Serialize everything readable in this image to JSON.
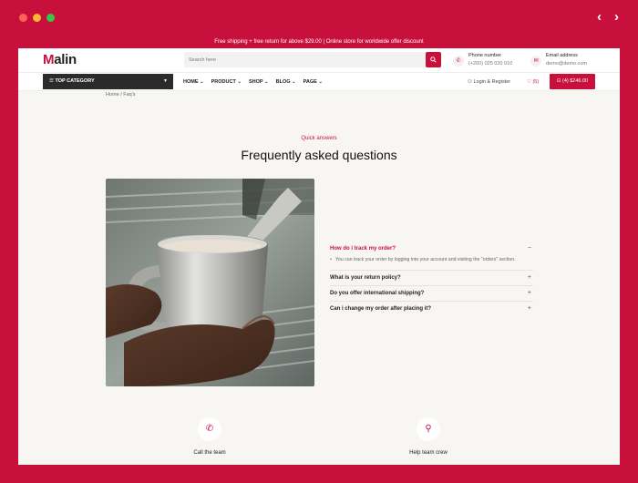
{
  "topbar": {
    "message": "Free shipping + free return for above $29.00  |  Online store for worldwide offer discount"
  },
  "header": {
    "logo_first": "M",
    "logo_rest": "alin",
    "search_placeholder": "Search here",
    "phone_label": "Phone number",
    "phone_value": "(+260) 025 020 010",
    "email_label": "Email address",
    "email_value": "demo@demo.com"
  },
  "menubar": {
    "top_category": "TOP CATEGORY",
    "items": [
      {
        "label": "HOME ⌄"
      },
      {
        "label": "PRODUCT ⌄"
      },
      {
        "label": "SHOP ⌄"
      },
      {
        "label": "BLOG ⌄"
      },
      {
        "label": "PAGE ⌄"
      }
    ],
    "login": "Login & Register",
    "wishlist": "(5)",
    "cart": "(4) $246.00"
  },
  "breadcrumb": "Home / Faq's",
  "faq_section": {
    "eyebrow": "Quick answers",
    "title": "Frequently asked questions",
    "items": [
      {
        "question": "How do i track my order?",
        "answer": "You can track your order by logging into your account and visiting the \"orders\" section.",
        "toggle": "−"
      },
      {
        "question": "What is your return policy?",
        "toggle": "+"
      },
      {
        "question": "Do you offer international shipping?",
        "toggle": "+"
      },
      {
        "question": "Can i change my order after placing it?",
        "toggle": "+"
      }
    ]
  },
  "help": {
    "call_title": "Call the team",
    "crew_title": "Help team crew"
  },
  "colors": {
    "brand": "#c8103c",
    "background": "#f8f6f2"
  }
}
